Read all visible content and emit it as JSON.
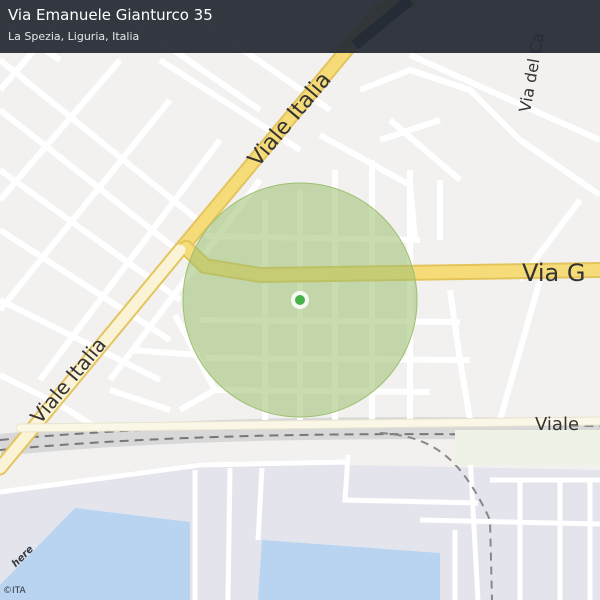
{
  "header": {
    "title": "Via Emanuele Gianturco 35",
    "subtitle": "La Spezia, Liguria, Italia"
  },
  "map": {
    "streets": {
      "viale_italia_upper": "Viale  Italia",
      "viale_italia_lower": "Viale  Italia",
      "via_g": "Via  G",
      "via_del_ca": "Via del Ca",
      "viale_right": "Viale"
    },
    "colors": {
      "background": "#f2f1ef",
      "major_road": "#f5dc78",
      "minor_road": "#ffffff",
      "water": "#b8d4f0",
      "port_area": "#e4e4ec",
      "accuracy_circle": "#9cbf6f",
      "location_dot": "#44b14a"
    },
    "marker_icon": "location-dot-icon"
  },
  "footer": {
    "brand": "here",
    "copyright": "©ITA"
  }
}
